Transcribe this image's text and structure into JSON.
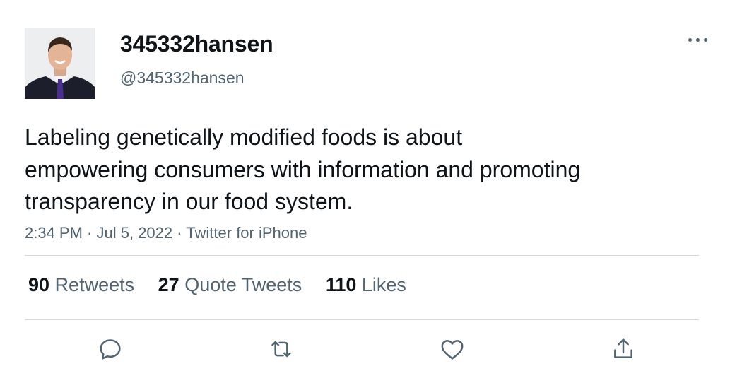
{
  "user": {
    "display_name": "345332hansen",
    "handle": "@345332hansen"
  },
  "tweet": {
    "lines": [
      "Labeling genetically modified foods is about",
      "empowering consumers with information and promoting",
      "transparency in our food system."
    ],
    "time": "2:34 PM",
    "date": "Jul 5, 2022",
    "source": "Twitter for iPhone",
    "separator": " · "
  },
  "stats": {
    "retweets": {
      "count": "90",
      "label": "Retweets"
    },
    "quotes": {
      "count": "27",
      "label": "Quote Tweets"
    },
    "likes": {
      "count": "110",
      "label": "Likes"
    }
  },
  "icons": {
    "more": "more-horizontal-icon",
    "reply": "reply-icon",
    "retweet": "retweet-icon",
    "like": "heart-icon",
    "share": "share-icon"
  },
  "colors": {
    "text": "#0f1419",
    "secondary": "#536471",
    "divider": "#cfd9de"
  }
}
